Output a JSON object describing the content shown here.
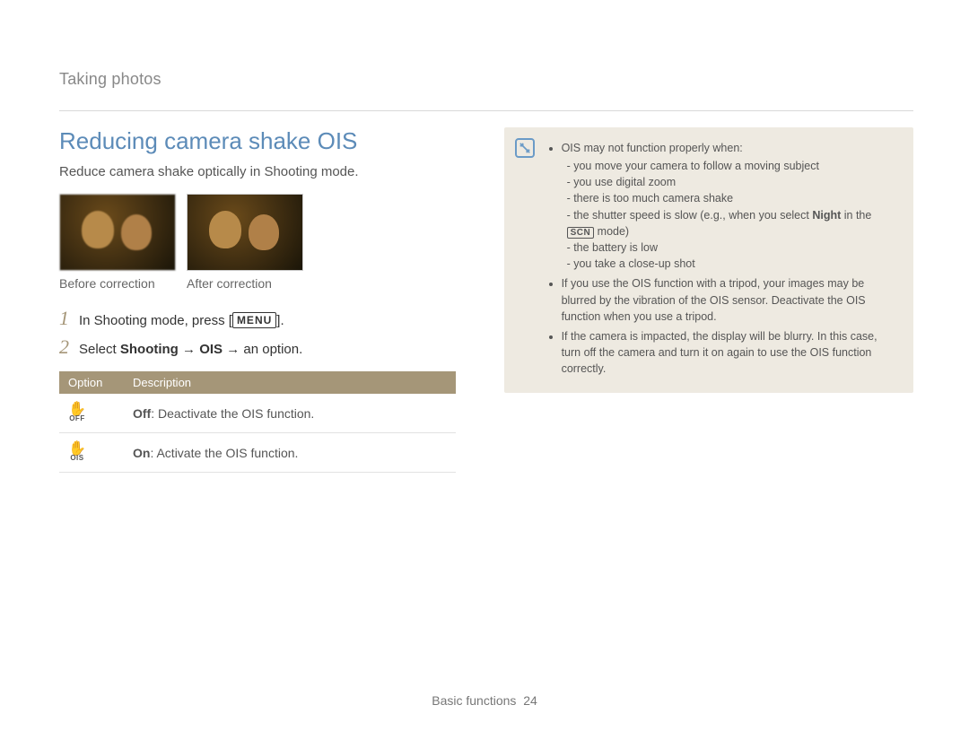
{
  "breadcrumb": "Taking photos",
  "heading": "Reducing camera shake OIS",
  "intro": "Reduce camera shake optically in Shooting mode.",
  "captions": {
    "before": "Before correction",
    "after": "After correction"
  },
  "steps": {
    "n1": "1",
    "s1a": "In Shooting mode, press [",
    "s1key": "MENU",
    "s1b": "].",
    "n2": "2",
    "s2a": "Select ",
    "s2b": "Shooting",
    "s2arr1": " → ",
    "s2c": "OIS",
    "s2arr2": " → ",
    "s2d": "an option."
  },
  "table": {
    "h1": "Option",
    "h2": "Description",
    "off_sub": "OFF",
    "off_b": "Off",
    "off_t": ": Deactivate the OIS function.",
    "on_sub": "OIS",
    "on_b": "On",
    "on_t": ": Activate the OIS function."
  },
  "notes": {
    "li1": "OIS may not function properly when:",
    "li1a": "you move your camera to follow a moving subject",
    "li1b": "you use digital zoom",
    "li1c": "there is too much camera shake",
    "li1d_a": "the shutter speed is slow (e.g., when you select ",
    "li1d_b": "Night",
    "li1d_c": " in the ",
    "li1d_scn": "SCN",
    "li1d_d": " mode)",
    "li1e": "the battery is low",
    "li1f": "you take a close-up shot",
    "li2": "If you use the OIS function with a tripod, your images may be blurred by the vibration of the OIS sensor. Deactivate the OIS function when you use a tripod.",
    "li3": "If the camera is impacted, the display will be blurry. In this case, turn off the camera and turn it on again to use the OIS function correctly."
  },
  "footer": {
    "section": "Basic functions",
    "page": "24"
  }
}
